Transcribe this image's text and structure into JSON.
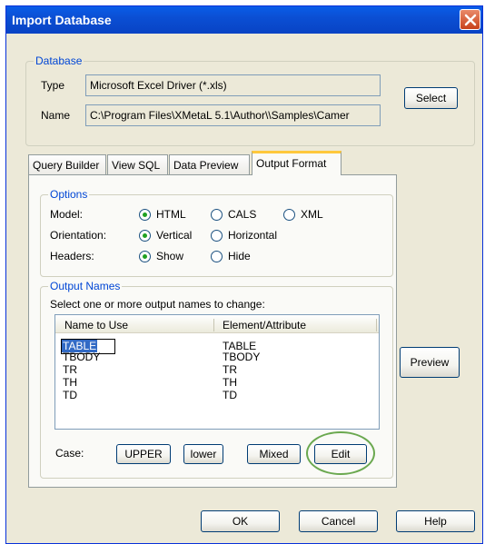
{
  "title": "Import Database",
  "database": {
    "legend": "Database",
    "type_label": "Type",
    "type_value": "Microsoft Excel Driver (*.xls)",
    "name_label": "Name",
    "name_value": "C:\\Program Files\\XMetaL 5.1\\Author\\\\Samples\\Camer",
    "select_button": "Select"
  },
  "tabs": [
    "Query Builder",
    "View SQL",
    "Data Preview",
    "Output Format"
  ],
  "active_tab": "Output Format",
  "options": {
    "legend": "Options",
    "model_label": "Model:",
    "model_options": [
      "HTML",
      "CALS",
      "XML"
    ],
    "model_selected": "HTML",
    "orientation_label": "Orientation:",
    "orientation_options": [
      "Vertical",
      "Horizontal"
    ],
    "orientation_selected": "Vertical",
    "headers_label": "Headers:",
    "headers_options": [
      "Show",
      "Hide"
    ],
    "headers_selected": "Show"
  },
  "output_names": {
    "legend": "Output Names",
    "instruction": "Select one or more output names to change:",
    "columns": [
      "Name to Use",
      "Element/Attribute"
    ],
    "rows": [
      [
        "TABLE",
        "TABLE"
      ],
      [
        "TBODY",
        "TBODY"
      ],
      [
        "TR",
        "TR"
      ],
      [
        "TH",
        "TH"
      ],
      [
        "TD",
        "TD"
      ]
    ],
    "editing_row": 0
  },
  "case": {
    "label": "Case:",
    "upper": "UPPER",
    "lower": "lower",
    "mixed": "Mixed",
    "edit": "Edit"
  },
  "preview_button": "Preview",
  "footer": {
    "ok": "OK",
    "cancel": "Cancel",
    "help": "Help"
  },
  "colors": {
    "title_bar": "#0b4fd4",
    "group_legend": "#0046d5",
    "active_tab_accent": "#ffc83c",
    "radio_dot": "#21a121",
    "annotation_ellipse": "#6aa84f",
    "selection": "#316ac5"
  }
}
